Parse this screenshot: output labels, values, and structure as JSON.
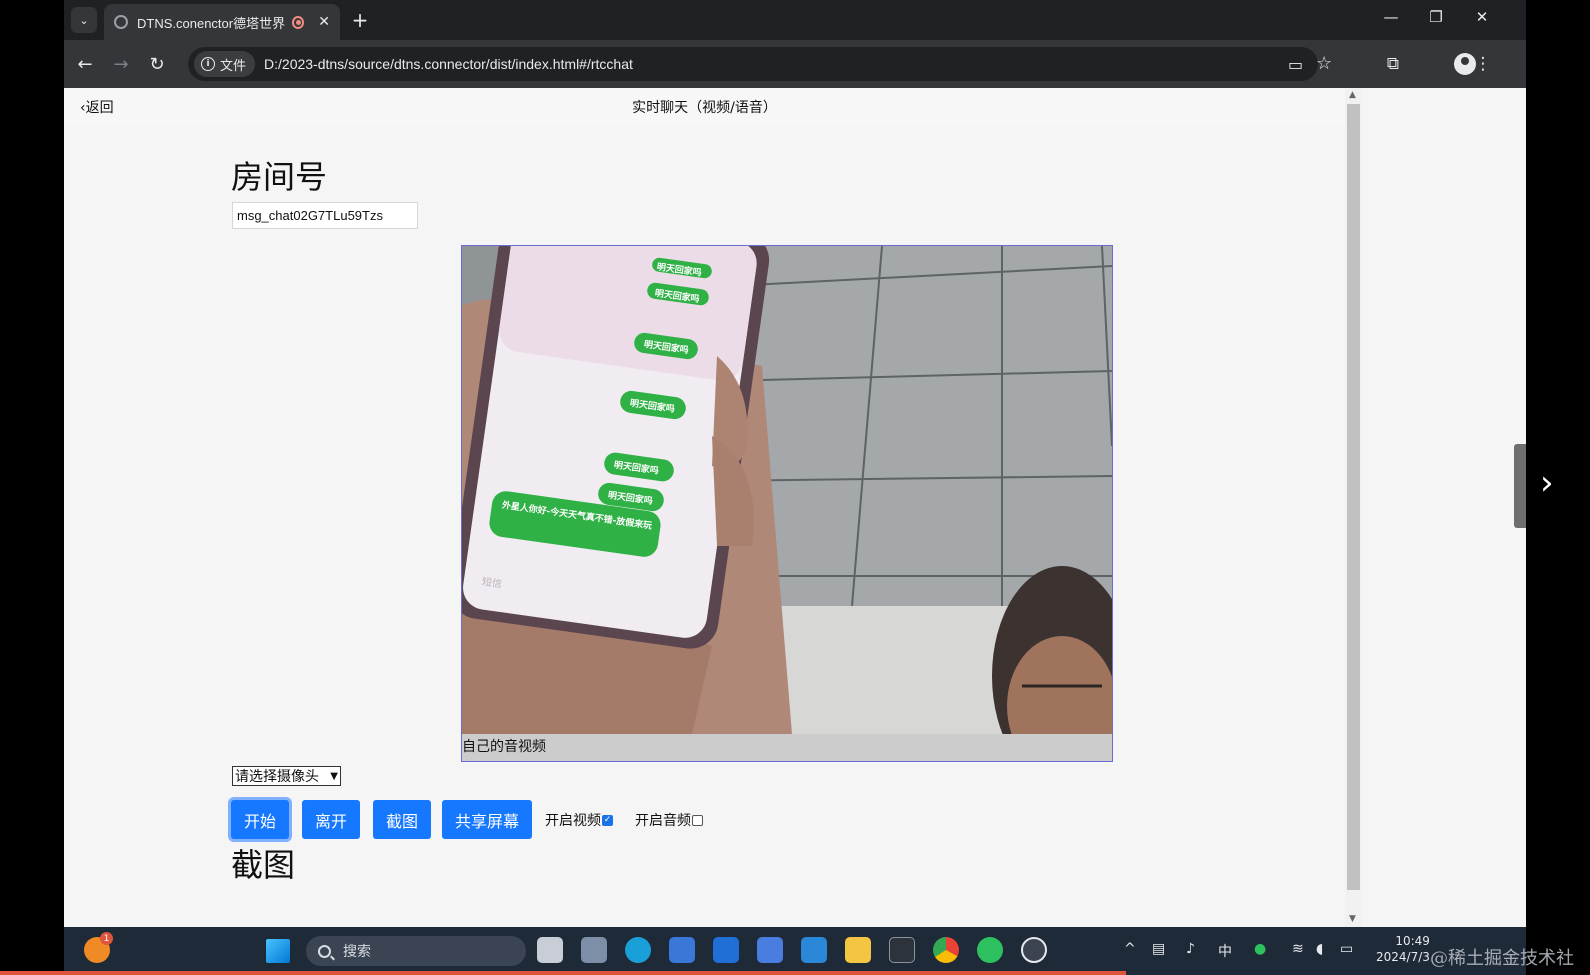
{
  "browser": {
    "tab_title": "DTNS.conenctor德塔世界",
    "url_chip": "文件",
    "url": "D:/2023-dtns/source/dtns.connector/dist/index.html#/rtcchat"
  },
  "page": {
    "back_label": "‹返回",
    "title": "实时聊天（视频/语音）",
    "room_heading": "房间号",
    "room_value": "msg_chat02G7TLu59Tzs",
    "video_caption": "自己的音视频",
    "camera_select": "请选择摄像头",
    "buttons": {
      "start": "开始",
      "leave": "离开",
      "screenshot": "截图",
      "share_screen": "共享屏幕"
    },
    "toggles": {
      "video_label": "开启视频",
      "video_checked": true,
      "audio_label": "开启音频",
      "audio_checked": false
    },
    "screenshot_heading": "截图"
  },
  "video_frame": {
    "chat_bubbles": [
      "明天回家吗",
      "明天回家吗",
      "明天回家吗",
      "明天回家吗",
      "明天回家吗",
      "明天回家吗",
      "外星人你好-今天天气真不错-放假来玩"
    ],
    "input_hint": "短信"
  },
  "taskbar": {
    "search_placeholder": "搜索",
    "ime_label": "中",
    "time": "10:49",
    "date": "2024/7/3",
    "notification_badge": "1"
  },
  "watermark": "@稀土掘金技术社区",
  "colors": {
    "primary_button": "#1677ff",
    "chrome_dark": "#202124",
    "chrome_toolbar": "#35363a",
    "taskbar": "#1f2a38"
  }
}
